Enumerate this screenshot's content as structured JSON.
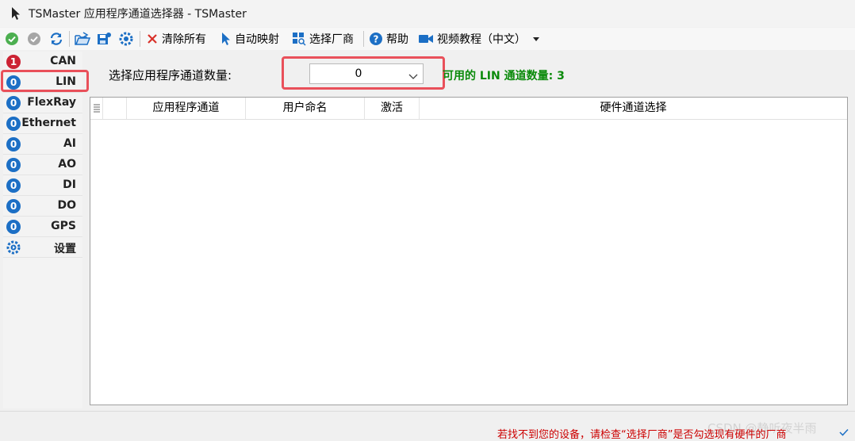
{
  "window": {
    "title": "TSMaster 应用程序通道选择器 - TSMaster"
  },
  "toolbar": {
    "icons": [
      "ok-icon",
      "disabled-ok-icon",
      "refresh-icon",
      "open-folder-icon",
      "save-icon",
      "settings-gear-icon"
    ],
    "clear_all": "清除所有",
    "auto_map": "自动映射",
    "select_vendor": "选择厂商",
    "help": "帮助",
    "video_tutorial": "视频教程（中文）"
  },
  "sidebar": {
    "items": [
      {
        "badge": "1",
        "label": "CAN",
        "badge_color": "#cc2233"
      },
      {
        "badge": "0",
        "label": "LIN",
        "badge_color": "#1c6fc5",
        "selected": true
      },
      {
        "badge": "0",
        "label": "FlexRay",
        "badge_color": "#1c6fc5"
      },
      {
        "badge": "0",
        "label": "Ethernet",
        "badge_color": "#1c6fc5"
      },
      {
        "badge": "0",
        "label": "AI",
        "badge_color": "#1c6fc5"
      },
      {
        "badge": "0",
        "label": "AO",
        "badge_color": "#1c6fc5"
      },
      {
        "badge": "0",
        "label": "DI",
        "badge_color": "#1c6fc5"
      },
      {
        "badge": "0",
        "label": "DO",
        "badge_color": "#1c6fc5"
      },
      {
        "badge": "0",
        "label": "GPS",
        "badge_color": "#1c6fc5"
      },
      {
        "label": "设置",
        "icon": "gear-icon"
      }
    ]
  },
  "main": {
    "channel_count_label": "选择应用程序通道数量:",
    "channel_count_value": "0",
    "available_text": "可用的 LIN 通道数量: 3",
    "table": {
      "columns": [
        "",
        "",
        "应用程序通道",
        "用户命名",
        "激活",
        "硬件通道选择"
      ],
      "rows": []
    }
  },
  "status": {
    "message": "若找不到您的设备，请检查“选择厂商”是否勾选现有硬件的厂商",
    "watermark": "CSDN @静听夜半雨"
  },
  "colors": {
    "highlight": "#e9505a",
    "available_text": "#0a8a0a",
    "status_message": "#cc0000",
    "badge_blue": "#1c6fc5",
    "badge_red": "#cc2233"
  }
}
